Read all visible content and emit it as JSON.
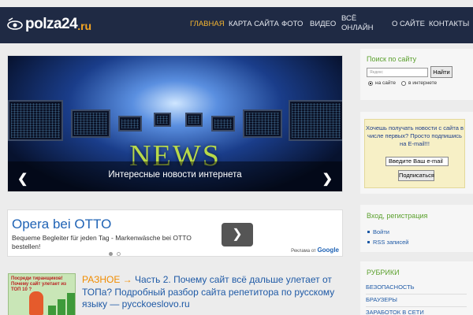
{
  "header": {
    "logo_main": "polza24",
    "logo_suffix": ".ru",
    "nav": [
      {
        "label": "ГЛАВНАЯ",
        "active": true
      },
      {
        "label": "КАРТА САЙТА",
        "active": false
      },
      {
        "label": "ФОТО",
        "active": false
      },
      {
        "label": "ВИДЕО",
        "active": false
      },
      {
        "label_line1": "ВСЁ",
        "label_line2": "ОНЛАЙН",
        "active": false
      },
      {
        "label": "О САЙТЕ",
        "active": false
      },
      {
        "label": "КОНТАКТЫ",
        "active": false
      }
    ]
  },
  "slider": {
    "image_text": "NEWS",
    "caption": "Интересные новости интернета",
    "prev_icon": "chevron-left-icon",
    "next_icon": "chevron-right-icon"
  },
  "ad": {
    "title": "Opera bei OTTO",
    "text": "Bequeme Begleiter für jeden Tag - Markenwäsche bei OTTO bestellen!",
    "button_icon": "chevron-right-icon",
    "footer_prefix": "Реклама от",
    "footer_brand": "Google"
  },
  "post": {
    "thumb_label": "Посреди тиранщиков! Почему сайт улетает из ТОП 10 ?",
    "category": "РАЗНОЕ →",
    "title": " Часть 2. Почему сайт всё дальше улетает от ТОПа? Подробный разбор сайта репетитора по русскому языку — pycckoeslovo.ru"
  },
  "sidebar": {
    "search_title": "Поиск по сайту",
    "search_placeholder": "Яндекс",
    "search_button": "Найти",
    "radio_site": "на сайте",
    "radio_web": "в интернете",
    "subscribe_text": "Хочешь получать новости с сайта в числе первых? Просто подпишись на E-mail!!!",
    "subscribe_input": "Введите Ваш e-mail",
    "subscribe_button": "Подписаться",
    "login_title": "Вход, регистрация",
    "login_links": [
      "Войти",
      "RSS записей"
    ],
    "rubrics_title": "РУБРИКИ",
    "rubrics": [
      "БЕЗОПАСНОСТЬ",
      "БРАУЗЕРЫ",
      "ЗАРАБОТОК В СЕТИ"
    ]
  },
  "colors": {
    "header_bg": "#1f2a44",
    "nav_active": "#f7b731",
    "logo_accent": "#f5a623",
    "link": "#1f5aa6",
    "sidebar_title": "#5aa02c",
    "category": "#f08c00"
  }
}
